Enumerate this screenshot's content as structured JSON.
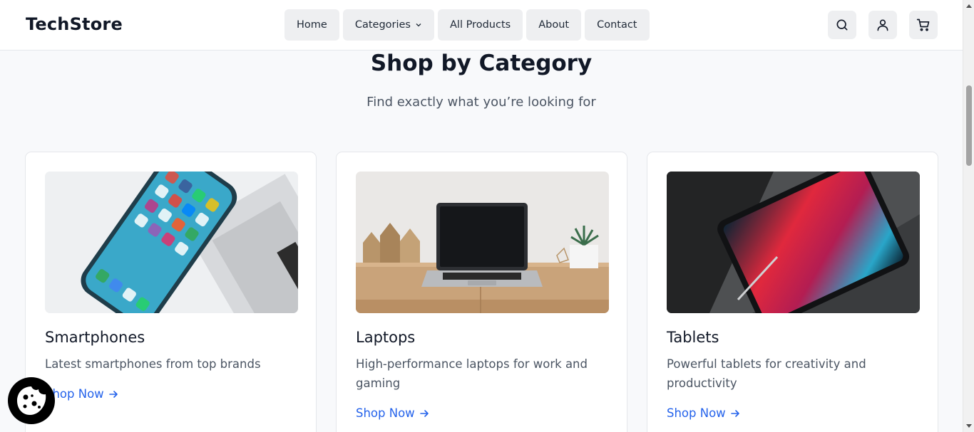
{
  "header": {
    "logo": "TechStore",
    "nav": [
      "Home",
      "Categories",
      "All Products",
      "About",
      "Contact"
    ],
    "icons": [
      "search-icon",
      "user-icon",
      "cart-icon"
    ]
  },
  "section": {
    "title": "Shop by Category",
    "subtitle": "Find exactly what you’re looking for"
  },
  "categories": [
    {
      "title": "Smartphones",
      "description": "Latest smartphones from top brands",
      "link": "Shop Now"
    },
    {
      "title": "Laptops",
      "description": "High-performance laptops for work and gaming",
      "link": "Shop Now"
    },
    {
      "title": "Tablets",
      "description": "Powerful tablets for creativity and productivity",
      "link": "Shop Now"
    }
  ],
  "colors": {
    "accent": "#2563eb",
    "text": "#111827",
    "muted": "#4b5563",
    "nav_bg": "#eeeff1",
    "page_bg": "#f8f9fb"
  },
  "cookie_button": "cookie-icon"
}
